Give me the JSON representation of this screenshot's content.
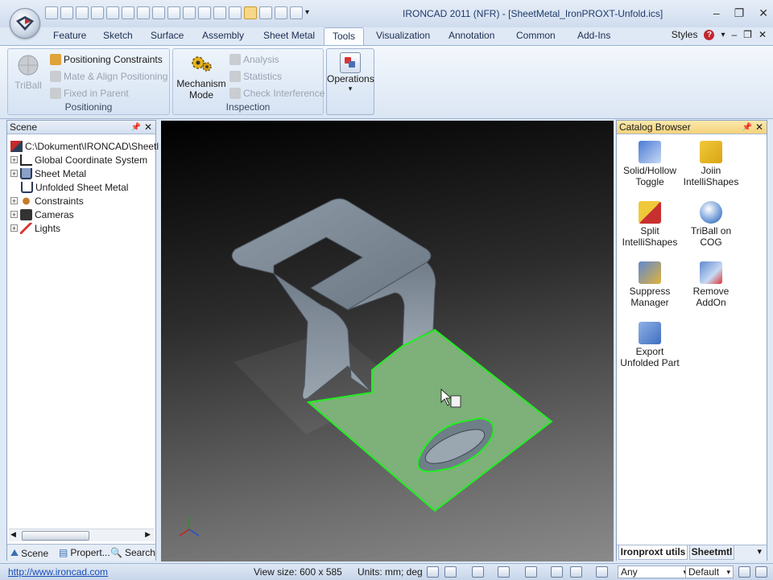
{
  "window": {
    "title": "IRONCAD 2011 (NFR) - [SheetMetal_IronPROXT-Unfold.ics]",
    "minimize": "–",
    "restore": "❐",
    "close": "✕"
  },
  "ribbon_tabs": [
    "Feature",
    "Sketch",
    "Surface",
    "Assembly",
    "Sheet Metal",
    "Tools",
    "Visualization",
    "Annotation",
    "Common",
    "Add-Ins"
  ],
  "active_tab": "Tools",
  "styles_label": "Styles",
  "ribbon": {
    "positioning": {
      "label": "Positioning",
      "triball": "TriBall",
      "positioning_constraints": "Positioning Constraints",
      "mate_align": "Mate & Align Positioning",
      "fixed_in_parent": "Fixed in Parent"
    },
    "inspection": {
      "label": "Inspection",
      "mechanism_mode_1": "Mechanism",
      "mechanism_mode_2": "Mode",
      "analysis": "Analysis",
      "statistics": "Statistics",
      "check_interference": "Check Interference"
    },
    "operations": {
      "label": "Operations"
    }
  },
  "scene_panel": {
    "title": "Scene",
    "root": "C:\\Dokument\\IRONCAD\\Sheetl",
    "items": [
      "Global Coordinate System",
      "Sheet Metal",
      "Unfolded Sheet Metal",
      "Constraints",
      "Cameras",
      "Lights"
    ],
    "tabs": [
      "Scene",
      "Propert...",
      "Search"
    ]
  },
  "catalog_panel": {
    "title": "Catalog Browser",
    "items": [
      {
        "line1": "Solid/Hollow",
        "line2": "Toggle"
      },
      {
        "line1": "Joiin",
        "line2": "IntelliShapes"
      },
      {
        "line1": "Split",
        "line2": "IntelliShapes"
      },
      {
        "line1": "TriBall on",
        "line2": "COG"
      },
      {
        "line1": "Suppress",
        "line2": "Manager"
      },
      {
        "line1": "Remove",
        "line2": "AddOn"
      },
      {
        "line1": "Export",
        "line2": "Unfolded Part"
      }
    ],
    "tabs": [
      "Ironproxt utils",
      "Sheetmtl"
    ]
  },
  "status": {
    "url": "http://www.ironcad.com",
    "view_size": "View size:  600 x 585",
    "units": "Units: mm; deg",
    "filter": "Any",
    "style": "Default"
  },
  "colors": {
    "accent": "#1f3a6b",
    "highlight_edge": "#22ee22",
    "part_face": "#7f8c98",
    "selected_face": "#7fb07a"
  }
}
